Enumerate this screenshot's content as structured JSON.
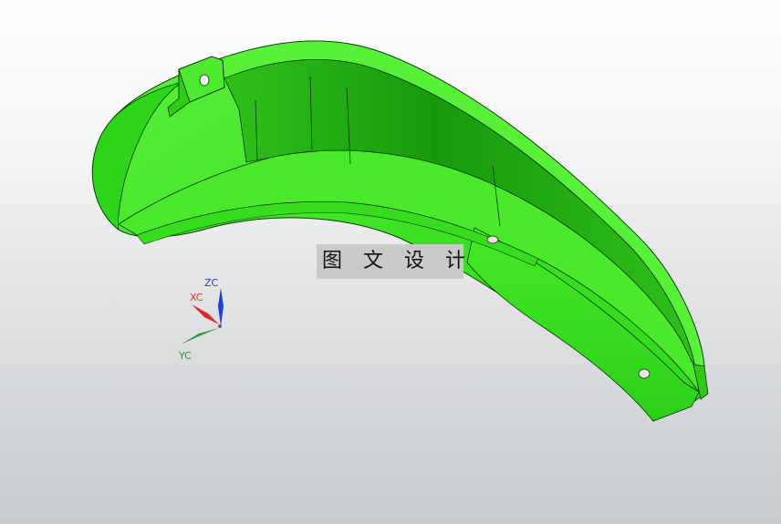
{
  "viewport": {
    "background": "gradient-grey",
    "model_color": "#33e81a",
    "model_edge_color": "#0a2a05"
  },
  "watermark": {
    "text": "图 文 设 计"
  },
  "triad": {
    "zc_label": "ZC",
    "xc_label": "XC",
    "yc_label": "YC",
    "zc_color": "#1f3fd6",
    "xc_color": "#d62a2a",
    "yc_color": "#1f9a3a"
  }
}
